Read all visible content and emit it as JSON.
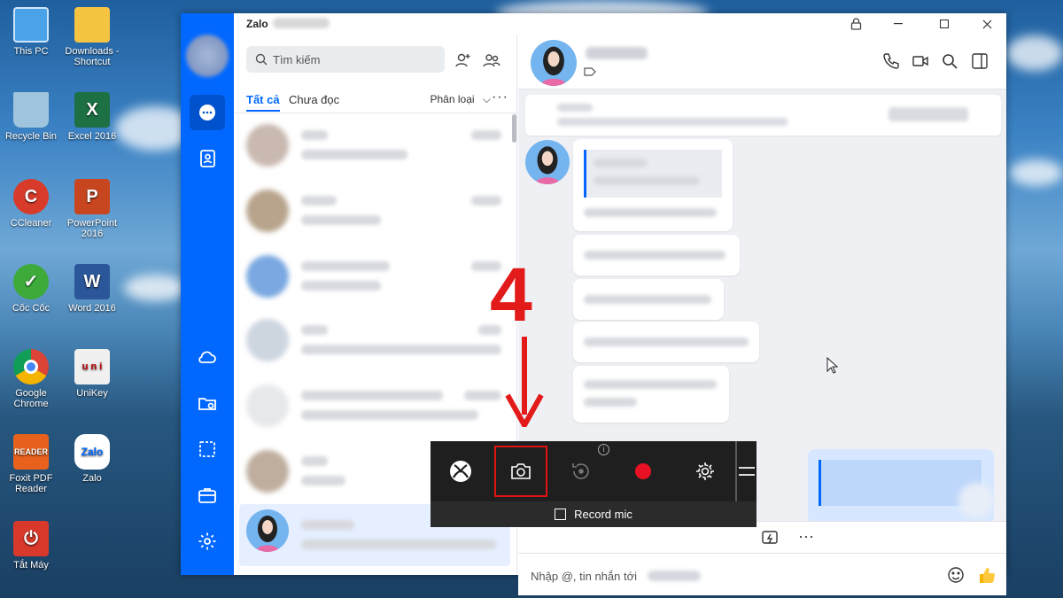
{
  "desktop": {
    "icons": [
      {
        "label": "This PC",
        "icon": "computer-icon"
      },
      {
        "label": "Downloads -\nShortcut",
        "icon": "folder-icon"
      },
      {
        "label": "Recycle Bin",
        "icon": "recycle-bin-icon"
      },
      {
        "label": "Excel 2016",
        "icon": "excel-icon"
      },
      {
        "label": "CCleaner",
        "icon": "ccleaner-icon"
      },
      {
        "label": "PowerPoint\n2016",
        "icon": "powerpoint-icon"
      },
      {
        "label": "Cốc Cốc",
        "icon": "coccoc-icon"
      },
      {
        "label": "Word 2016",
        "icon": "word-icon"
      },
      {
        "label": "Google\nChrome",
        "icon": "chrome-icon"
      },
      {
        "label": "UniKey",
        "icon": "unikey-icon"
      },
      {
        "label": "Foxit PDF\nReader",
        "icon": "foxit-icon"
      },
      {
        "label": "Zalo",
        "icon": "zalo-icon"
      },
      {
        "label": "Tắt Máy",
        "icon": "power-icon"
      }
    ]
  },
  "zalo": {
    "app_title": "Zalo",
    "search_placeholder": "Tìm kiếm",
    "filters": {
      "all": "Tất cả",
      "unread": "Chưa đọc",
      "classify": "Phân loại"
    },
    "composer_placeholder": "Nhập @, tin nhắn tới",
    "brand_color": "#0068ff"
  },
  "gamebar": {
    "record_mic_label": "Record mic",
    "record_mic_checked": false,
    "info_glyph": "i",
    "buttons": [
      "xbox-icon",
      "camera-icon",
      "replay-icon",
      "record-icon",
      "gear-icon"
    ],
    "highlight_color": "#e31212"
  },
  "annotation": {
    "step": "4",
    "color": "#e21a1a"
  }
}
